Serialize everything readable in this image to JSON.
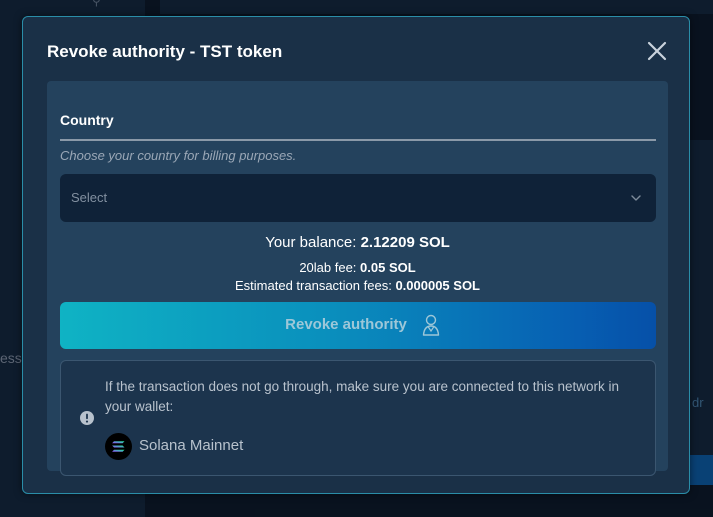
{
  "modal": {
    "title": "Revoke authority - TST token"
  },
  "country": {
    "label": "Country",
    "hint": "Choose your country for billing purposes.",
    "select_value": "Select"
  },
  "fees": {
    "balance_label": "Your balance:",
    "balance_value": "2.12209 SOL",
    "lab_fee_label": "20lab fee:",
    "lab_fee_value": "0.05 SOL",
    "est_fee_label": "Estimated transaction fees:",
    "est_fee_value": "0.000005 SOL"
  },
  "revoke_button": {
    "label": "Revoke authority",
    "icon": "user-icon"
  },
  "notice": {
    "text": "If the transaction does not go through, make sure you are connected to this network in your wallet:",
    "icon": "exclamation-circle-icon",
    "network_name": "Solana Mainnet",
    "network_icon": "solana-logo"
  },
  "background": {
    "left_text": "ess",
    "right_text": "dr"
  },
  "colors": {
    "modal_bg": "#1a3047",
    "inner_bg": "#24425d",
    "accent_border": "#2a8da8",
    "button_gradient_start": "#0fb3c4",
    "button_gradient_end": "#0650a8"
  }
}
